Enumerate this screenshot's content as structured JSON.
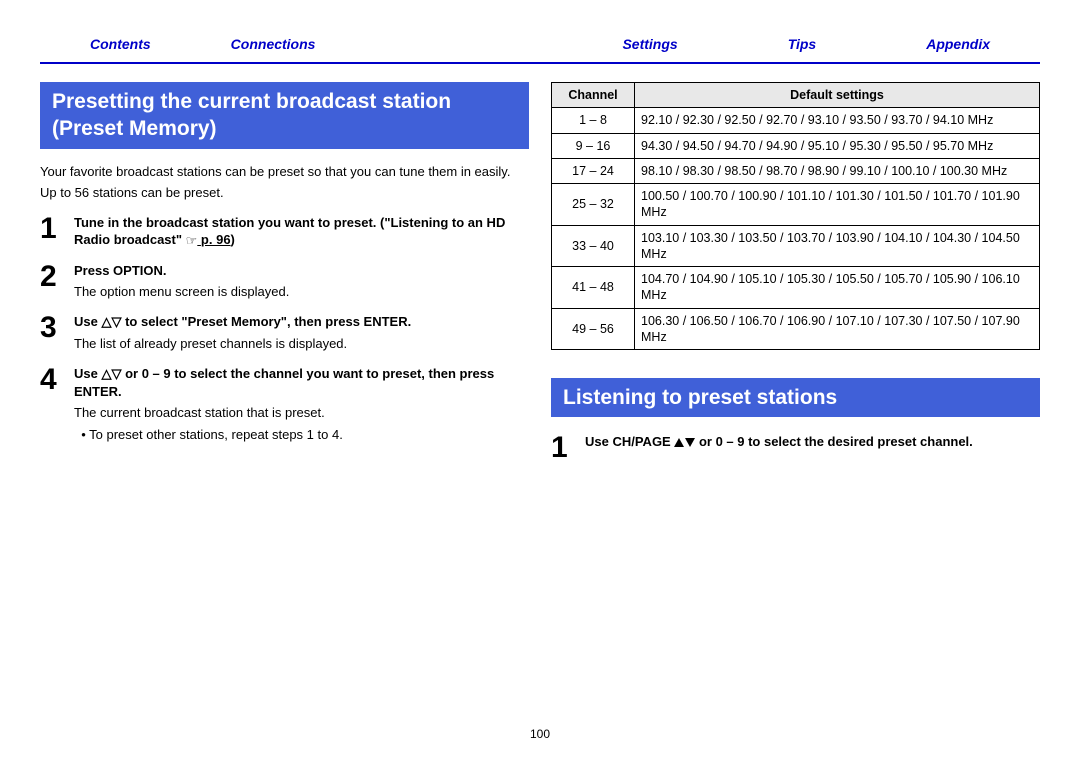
{
  "nav": {
    "contents": "Contents",
    "connections": "Connections",
    "settings": "Settings",
    "tips": "Tips",
    "appendix": "Appendix"
  },
  "section1": {
    "title": "Presetting the current broadcast station (Preset Memory)",
    "intro1": "Your favorite broadcast stations can be preset so that you can tune them in easily.",
    "intro2": "Up to 56 stations can be preset.",
    "step1_a": "Tune in the broadcast station you want to preset. (\"Listening to an HD Radio broadcast\" ",
    "step1_page": "p. 96",
    "step1_b": ")",
    "step2_a": "Press OPTION.",
    "step2_b": "The option menu screen is displayed.",
    "step3_a_pre": "Use ",
    "step3_a_post": " to select \"Preset Memory\", then press ENTER.",
    "step3_b": "The list of already preset channels is displayed.",
    "step4_a_pre": "Use ",
    "step4_a_post": " or 0 – 9 to select the channel you want to preset, then press ENTER.",
    "step4_b": "The current broadcast station that is preset.",
    "step4_bullet": "To preset other stations, repeat steps 1 to 4."
  },
  "table": {
    "h1": "Channel",
    "h2": "Default settings",
    "rows": [
      {
        "ch": "1 – 8",
        "val": "92.10 / 92.30 / 92.50 / 92.70 / 93.10 / 93.50 / 93.70 / 94.10 MHz"
      },
      {
        "ch": "9 – 16",
        "val": "94.30 / 94.50 / 94.70 / 94.90 / 95.10 / 95.30 / 95.50 / 95.70 MHz"
      },
      {
        "ch": "17 – 24",
        "val": "98.10 / 98.30 / 98.50 / 98.70 / 98.90 / 99.10 / 100.10 / 100.30 MHz"
      },
      {
        "ch": "25 – 32",
        "val": "100.50 / 100.70 / 100.90 / 101.10 / 101.30 / 101.50 / 101.70 / 101.90 MHz"
      },
      {
        "ch": "33 – 40",
        "val": "103.10 / 103.30 / 103.50 / 103.70 / 103.90 / 104.10 / 104.30 / 104.50 MHz"
      },
      {
        "ch": "41 – 48",
        "val": "104.70 / 104.90 / 105.10 / 105.30 / 105.50 / 105.70 / 105.90 / 106.10 MHz"
      },
      {
        "ch": "49 – 56",
        "val": "106.30 / 106.50 / 106.70 / 106.90 / 107.10 / 107.30 / 107.50 / 107.90 MHz"
      }
    ]
  },
  "section2": {
    "title": "Listening to preset stations",
    "step1_a": "Use CH/PAGE ",
    "step1_b": " or 0 – 9 to select the desired preset channel."
  },
  "page_number": "100"
}
